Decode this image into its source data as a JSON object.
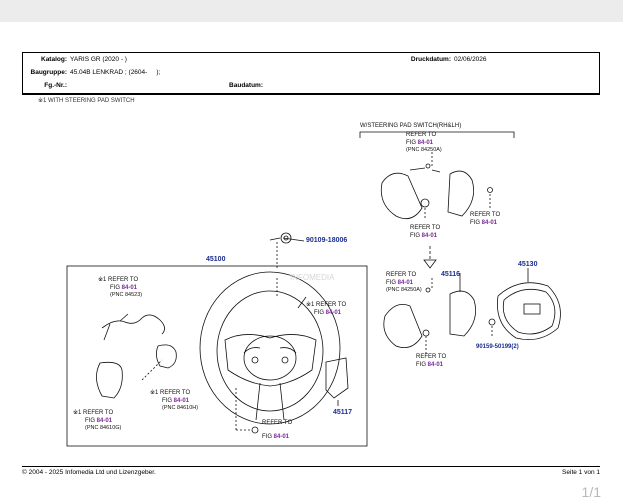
{
  "header": {
    "katalog_label": "Katalog:",
    "katalog_value": "YARIS GR (2020 - )",
    "druckdatum_label": "Druckdatum:",
    "druckdatum_value": "02/06/2026",
    "baugruppe_label": "Baugruppe:",
    "baugruppe_value": "45.04B LENKRAD ; (2604-     );",
    "fgnr_label": "Fg.-Nr.:",
    "fgnr_value": "",
    "baudatum_label": "Baudatum:",
    "baudatum_value": ""
  },
  "cut_text": "※1 WITH STEERING PAD SWITCH",
  "diagram": {
    "watermark": "INFOMEDIA",
    "pad_switch_title": "W/STEERING PAD SWITCH(RH&LH)",
    "p45100": "45100",
    "p45116": "45116",
    "p45130": "45130",
    "p45117": "45117",
    "p90109": "90109-18006",
    "p90159": "90159-50199(2)",
    "refer_to": "REFER TO",
    "refer_to_x1": "※1 REFER TO",
    "fig_prefix": "FIG",
    "fig_8401": "84-01",
    "pnc_84250a": "(PNC 84250A)",
    "pnc_84523": "(PNC 84523)",
    "pnc_84610h": "(PNC 84610H)",
    "pnc_84610g": "(PNC 84610G)"
  },
  "footer": {
    "copyright": "© 2004 - 2025 Infomedia Ltd und Lizenzgeber.",
    "page_text": "Seite 1 von 1",
    "page_indicator": "1/1"
  },
  "colors": {
    "part_number": "#1a2d8f",
    "figure_link": "#7a2a9a",
    "line": "#111111"
  }
}
